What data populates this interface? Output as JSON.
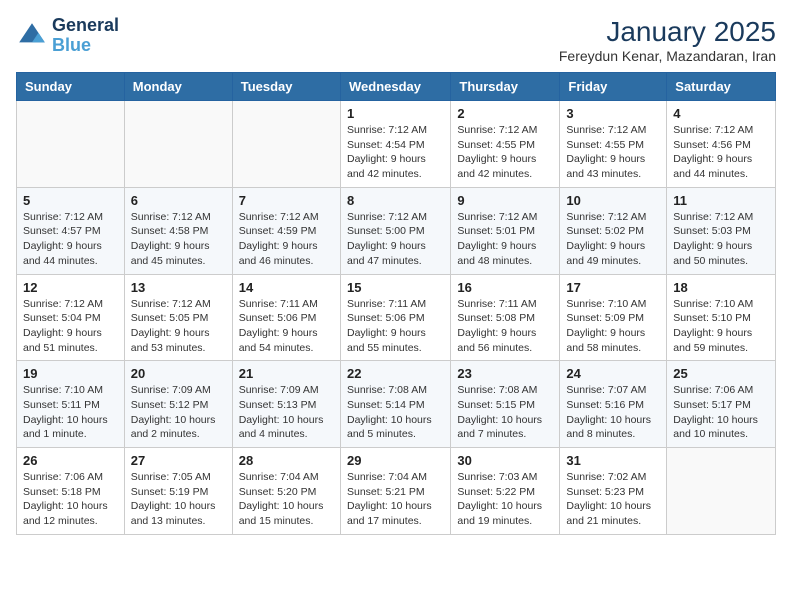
{
  "logo": {
    "line1": "General",
    "line2": "Blue"
  },
  "title": {
    "month_year": "January 2025",
    "location": "Fereydun Kenar, Mazandaran, Iran"
  },
  "weekdays": [
    "Sunday",
    "Monday",
    "Tuesday",
    "Wednesday",
    "Thursday",
    "Friday",
    "Saturday"
  ],
  "weeks": [
    [
      {
        "day": "",
        "detail": ""
      },
      {
        "day": "",
        "detail": ""
      },
      {
        "day": "",
        "detail": ""
      },
      {
        "day": "1",
        "detail": "Sunrise: 7:12 AM\nSunset: 4:54 PM\nDaylight: 9 hours and 42 minutes."
      },
      {
        "day": "2",
        "detail": "Sunrise: 7:12 AM\nSunset: 4:55 PM\nDaylight: 9 hours and 42 minutes."
      },
      {
        "day": "3",
        "detail": "Sunrise: 7:12 AM\nSunset: 4:55 PM\nDaylight: 9 hours and 43 minutes."
      },
      {
        "day": "4",
        "detail": "Sunrise: 7:12 AM\nSunset: 4:56 PM\nDaylight: 9 hours and 44 minutes."
      }
    ],
    [
      {
        "day": "5",
        "detail": "Sunrise: 7:12 AM\nSunset: 4:57 PM\nDaylight: 9 hours and 44 minutes."
      },
      {
        "day": "6",
        "detail": "Sunrise: 7:12 AM\nSunset: 4:58 PM\nDaylight: 9 hours and 45 minutes."
      },
      {
        "day": "7",
        "detail": "Sunrise: 7:12 AM\nSunset: 4:59 PM\nDaylight: 9 hours and 46 minutes."
      },
      {
        "day": "8",
        "detail": "Sunrise: 7:12 AM\nSunset: 5:00 PM\nDaylight: 9 hours and 47 minutes."
      },
      {
        "day": "9",
        "detail": "Sunrise: 7:12 AM\nSunset: 5:01 PM\nDaylight: 9 hours and 48 minutes."
      },
      {
        "day": "10",
        "detail": "Sunrise: 7:12 AM\nSunset: 5:02 PM\nDaylight: 9 hours and 49 minutes."
      },
      {
        "day": "11",
        "detail": "Sunrise: 7:12 AM\nSunset: 5:03 PM\nDaylight: 9 hours and 50 minutes."
      }
    ],
    [
      {
        "day": "12",
        "detail": "Sunrise: 7:12 AM\nSunset: 5:04 PM\nDaylight: 9 hours and 51 minutes."
      },
      {
        "day": "13",
        "detail": "Sunrise: 7:12 AM\nSunset: 5:05 PM\nDaylight: 9 hours and 53 minutes."
      },
      {
        "day": "14",
        "detail": "Sunrise: 7:11 AM\nSunset: 5:06 PM\nDaylight: 9 hours and 54 minutes."
      },
      {
        "day": "15",
        "detail": "Sunrise: 7:11 AM\nSunset: 5:06 PM\nDaylight: 9 hours and 55 minutes."
      },
      {
        "day": "16",
        "detail": "Sunrise: 7:11 AM\nSunset: 5:08 PM\nDaylight: 9 hours and 56 minutes."
      },
      {
        "day": "17",
        "detail": "Sunrise: 7:10 AM\nSunset: 5:09 PM\nDaylight: 9 hours and 58 minutes."
      },
      {
        "day": "18",
        "detail": "Sunrise: 7:10 AM\nSunset: 5:10 PM\nDaylight: 9 hours and 59 minutes."
      }
    ],
    [
      {
        "day": "19",
        "detail": "Sunrise: 7:10 AM\nSunset: 5:11 PM\nDaylight: 10 hours and 1 minute."
      },
      {
        "day": "20",
        "detail": "Sunrise: 7:09 AM\nSunset: 5:12 PM\nDaylight: 10 hours and 2 minutes."
      },
      {
        "day": "21",
        "detail": "Sunrise: 7:09 AM\nSunset: 5:13 PM\nDaylight: 10 hours and 4 minutes."
      },
      {
        "day": "22",
        "detail": "Sunrise: 7:08 AM\nSunset: 5:14 PM\nDaylight: 10 hours and 5 minutes."
      },
      {
        "day": "23",
        "detail": "Sunrise: 7:08 AM\nSunset: 5:15 PM\nDaylight: 10 hours and 7 minutes."
      },
      {
        "day": "24",
        "detail": "Sunrise: 7:07 AM\nSunset: 5:16 PM\nDaylight: 10 hours and 8 minutes."
      },
      {
        "day": "25",
        "detail": "Sunrise: 7:06 AM\nSunset: 5:17 PM\nDaylight: 10 hours and 10 minutes."
      }
    ],
    [
      {
        "day": "26",
        "detail": "Sunrise: 7:06 AM\nSunset: 5:18 PM\nDaylight: 10 hours and 12 minutes."
      },
      {
        "day": "27",
        "detail": "Sunrise: 7:05 AM\nSunset: 5:19 PM\nDaylight: 10 hours and 13 minutes."
      },
      {
        "day": "28",
        "detail": "Sunrise: 7:04 AM\nSunset: 5:20 PM\nDaylight: 10 hours and 15 minutes."
      },
      {
        "day": "29",
        "detail": "Sunrise: 7:04 AM\nSunset: 5:21 PM\nDaylight: 10 hours and 17 minutes."
      },
      {
        "day": "30",
        "detail": "Sunrise: 7:03 AM\nSunset: 5:22 PM\nDaylight: 10 hours and 19 minutes."
      },
      {
        "day": "31",
        "detail": "Sunrise: 7:02 AM\nSunset: 5:23 PM\nDaylight: 10 hours and 21 minutes."
      },
      {
        "day": "",
        "detail": ""
      }
    ]
  ]
}
